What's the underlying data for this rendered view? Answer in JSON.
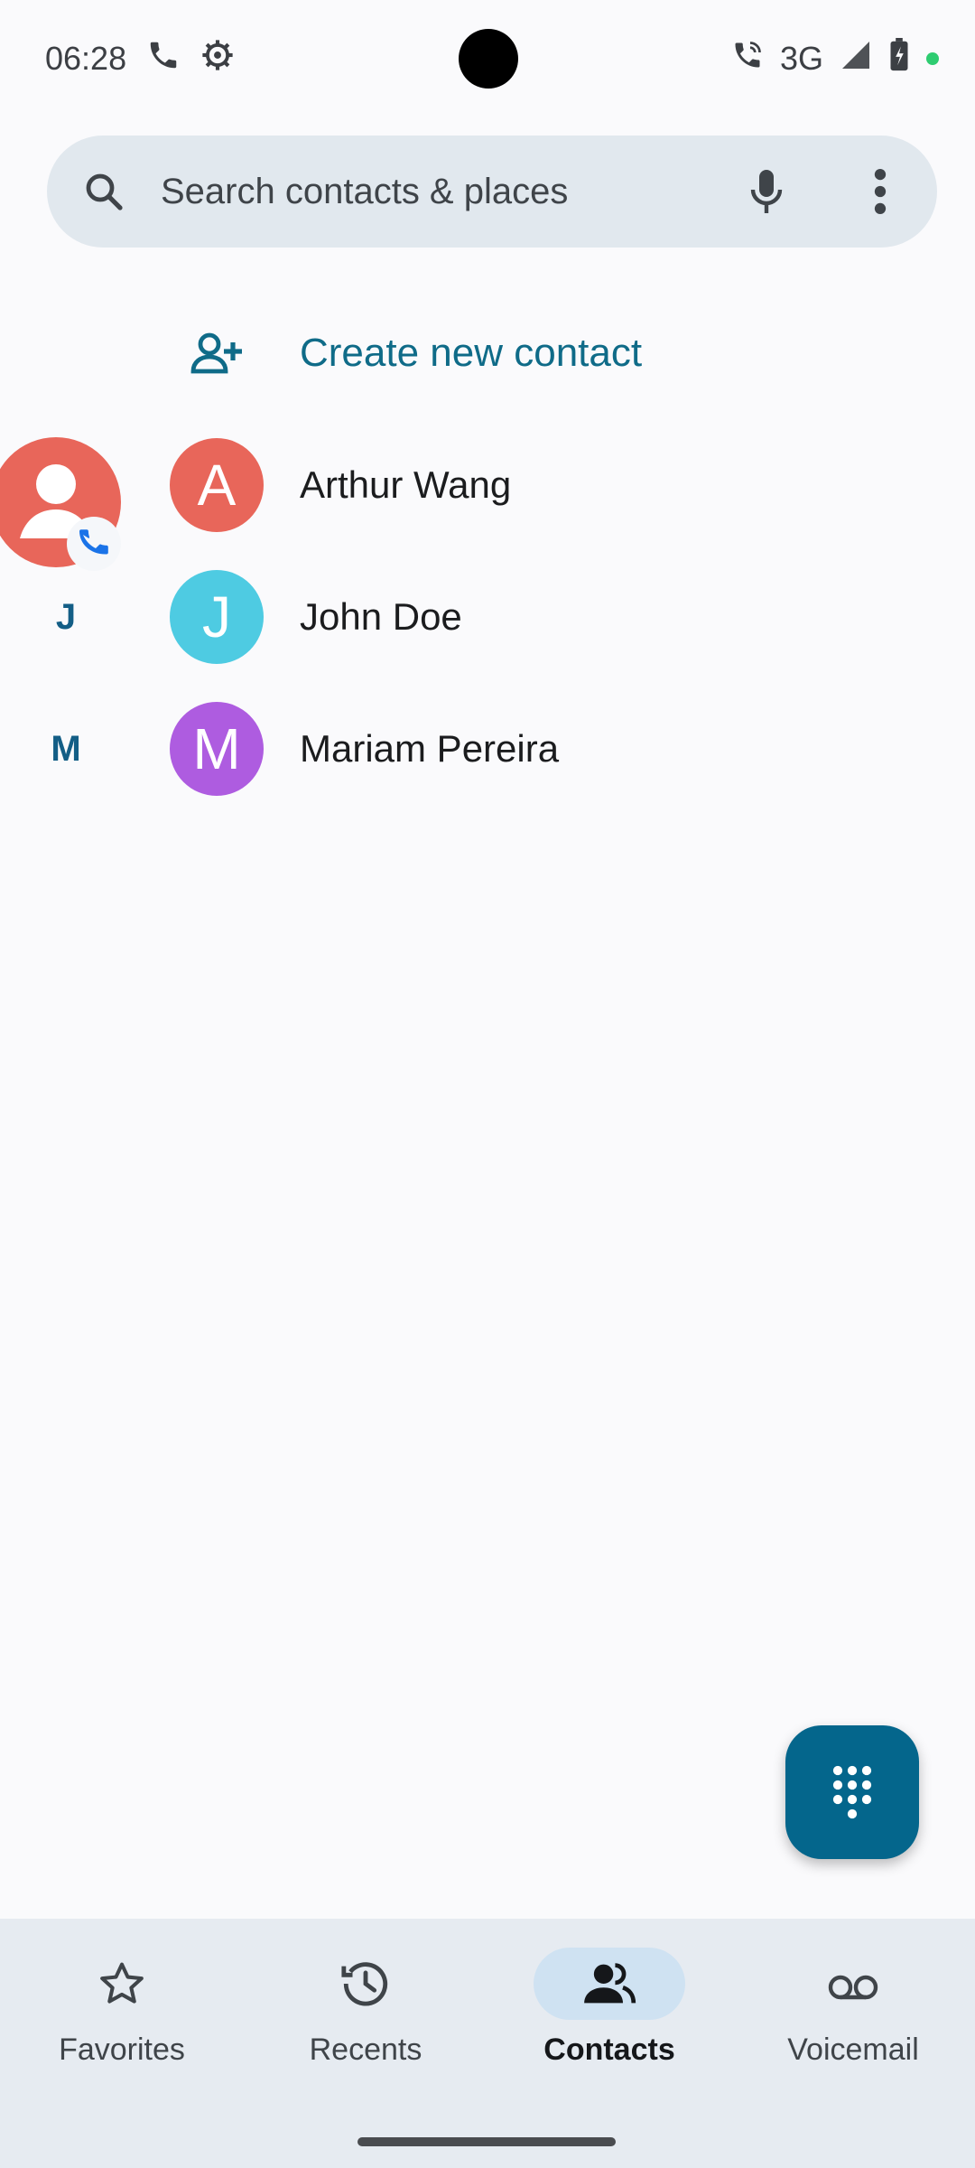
{
  "status_bar": {
    "time": "06:28",
    "network": "3G"
  },
  "search": {
    "placeholder": "Search contacts & places"
  },
  "create_contact": {
    "label": "Create new contact"
  },
  "contacts": [
    {
      "letter": "",
      "initial": "A",
      "name": "Arthur Wang",
      "color": "#e8665a"
    },
    {
      "letter": "J",
      "initial": "J",
      "name": "John Doe",
      "color": "#4ecbe2"
    },
    {
      "letter": "M",
      "initial": "M",
      "name": "Mariam Pereira",
      "color": "#ae5ce0"
    }
  ],
  "bottom_nav": {
    "items": [
      {
        "label": "Favorites",
        "icon": "star-icon",
        "active": false
      },
      {
        "label": "Recents",
        "icon": "recents-icon",
        "active": false
      },
      {
        "label": "Contacts",
        "icon": "contacts-icon",
        "active": true
      },
      {
        "label": "Voicemail",
        "icon": "voicemail-icon",
        "active": false
      }
    ]
  },
  "colors": {
    "accent": "#04668c",
    "search_bg": "#e1e8ee",
    "nav_bg": "#e6ebf1"
  }
}
